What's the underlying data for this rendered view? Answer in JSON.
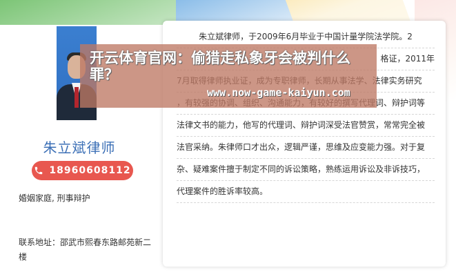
{
  "profile": {
    "name": "朱立斌律师",
    "phone": "18960608112",
    "practice_areas": "婚姻家庭, 刑事辩护",
    "address": "联系地址：邵武市熙春东路邮苑新二楼"
  },
  "bio": {
    "lines": [
      "朱立斌律师，于2009年6月毕业于中国计量学院法学院。2",
      "",
      "7月取得律师执业证，成为专职律师，长期从事法学、法律实务研究",
      "，有较强的协调、组织、沟通能力，有较好的撰写代理词、辩护词等",
      "法律文书的能力，他写的代理词、辩护词深受法官赞赏，常常完全被",
      "法官采纳。朱律师口才出众，逻辑严谨，思维及应变能力强。对于复",
      "杂、疑难案件擅于制定不同的诉讼策略，熟练运用诉讼及非诉技巧，",
      "代理案件的胜诉率较高。"
    ],
    "partial_line_2_right": "格证，2011年"
  },
  "overlay": {
    "title": "开云体育官网：偷猎走私象牙会被判什么罪？",
    "url": "www.now-game-kaiyun.com"
  },
  "colors": {
    "accent_red": "#e8574f",
    "name_blue": "#3b6fb6"
  },
  "icons": {
    "phone": "phone-icon"
  }
}
